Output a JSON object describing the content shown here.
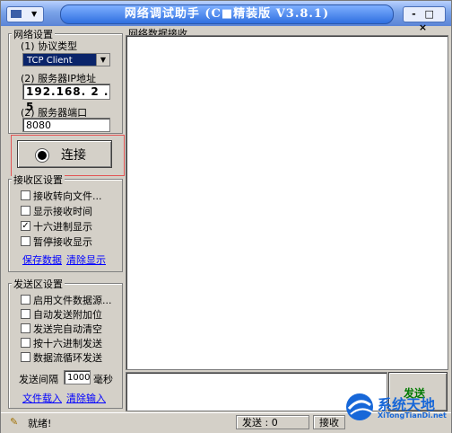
{
  "window": {
    "title": "网络调试助手 (C■精装版 V3.8.1)",
    "controls": "- □ ×"
  },
  "net_settings": {
    "group_label": "网络设置",
    "protocol_label": "(1) 协议类型",
    "protocol_value": "TCP Client",
    "ip_label": "(2) 服务器IP地址",
    "ip_value": "192.168. 2 . 5",
    "port_label": "(2) 服务器端口",
    "port_value": "8080",
    "connect_label": "连接"
  },
  "receive_settings": {
    "group_label": "接收区设置",
    "options": [
      {
        "label": "接收转向文件...",
        "checked": false
      },
      {
        "label": "显示接收时间",
        "checked": false
      },
      {
        "label": "十六进制显示",
        "checked": true
      },
      {
        "label": "暂停接收显示",
        "checked": false
      }
    ],
    "save_link": "保存数据",
    "clear_link": "清除显示"
  },
  "send_settings": {
    "group_label": "发送区设置",
    "options": [
      {
        "label": "启用文件数据源...",
        "checked": false
      },
      {
        "label": "自动发送附加位",
        "checked": false
      },
      {
        "label": "发送完自动清空",
        "checked": false
      },
      {
        "label": "按十六进制发送",
        "checked": false
      },
      {
        "label": "数据流循环发送",
        "checked": false
      }
    ],
    "interval_label": "发送间隔",
    "interval_value": "1000",
    "interval_unit": "毫秒",
    "load_link": "文件载入",
    "clear_link": "清除输入"
  },
  "receive_area": {
    "label": "网络数据接收"
  },
  "send_button": {
    "label": "发送"
  },
  "status": {
    "ready": "就绪!",
    "send_count": "发送 : 0",
    "recv_count": "接收"
  },
  "watermark": {
    "name": "系统天地",
    "url": "XiTongTianDi.net"
  },
  "colors": {
    "face": "#d4d0c8",
    "title_blue": "#2f6fe0",
    "link": "#0000ff",
    "highlight_frame": "#e25555",
    "send_green": "#007a00"
  }
}
